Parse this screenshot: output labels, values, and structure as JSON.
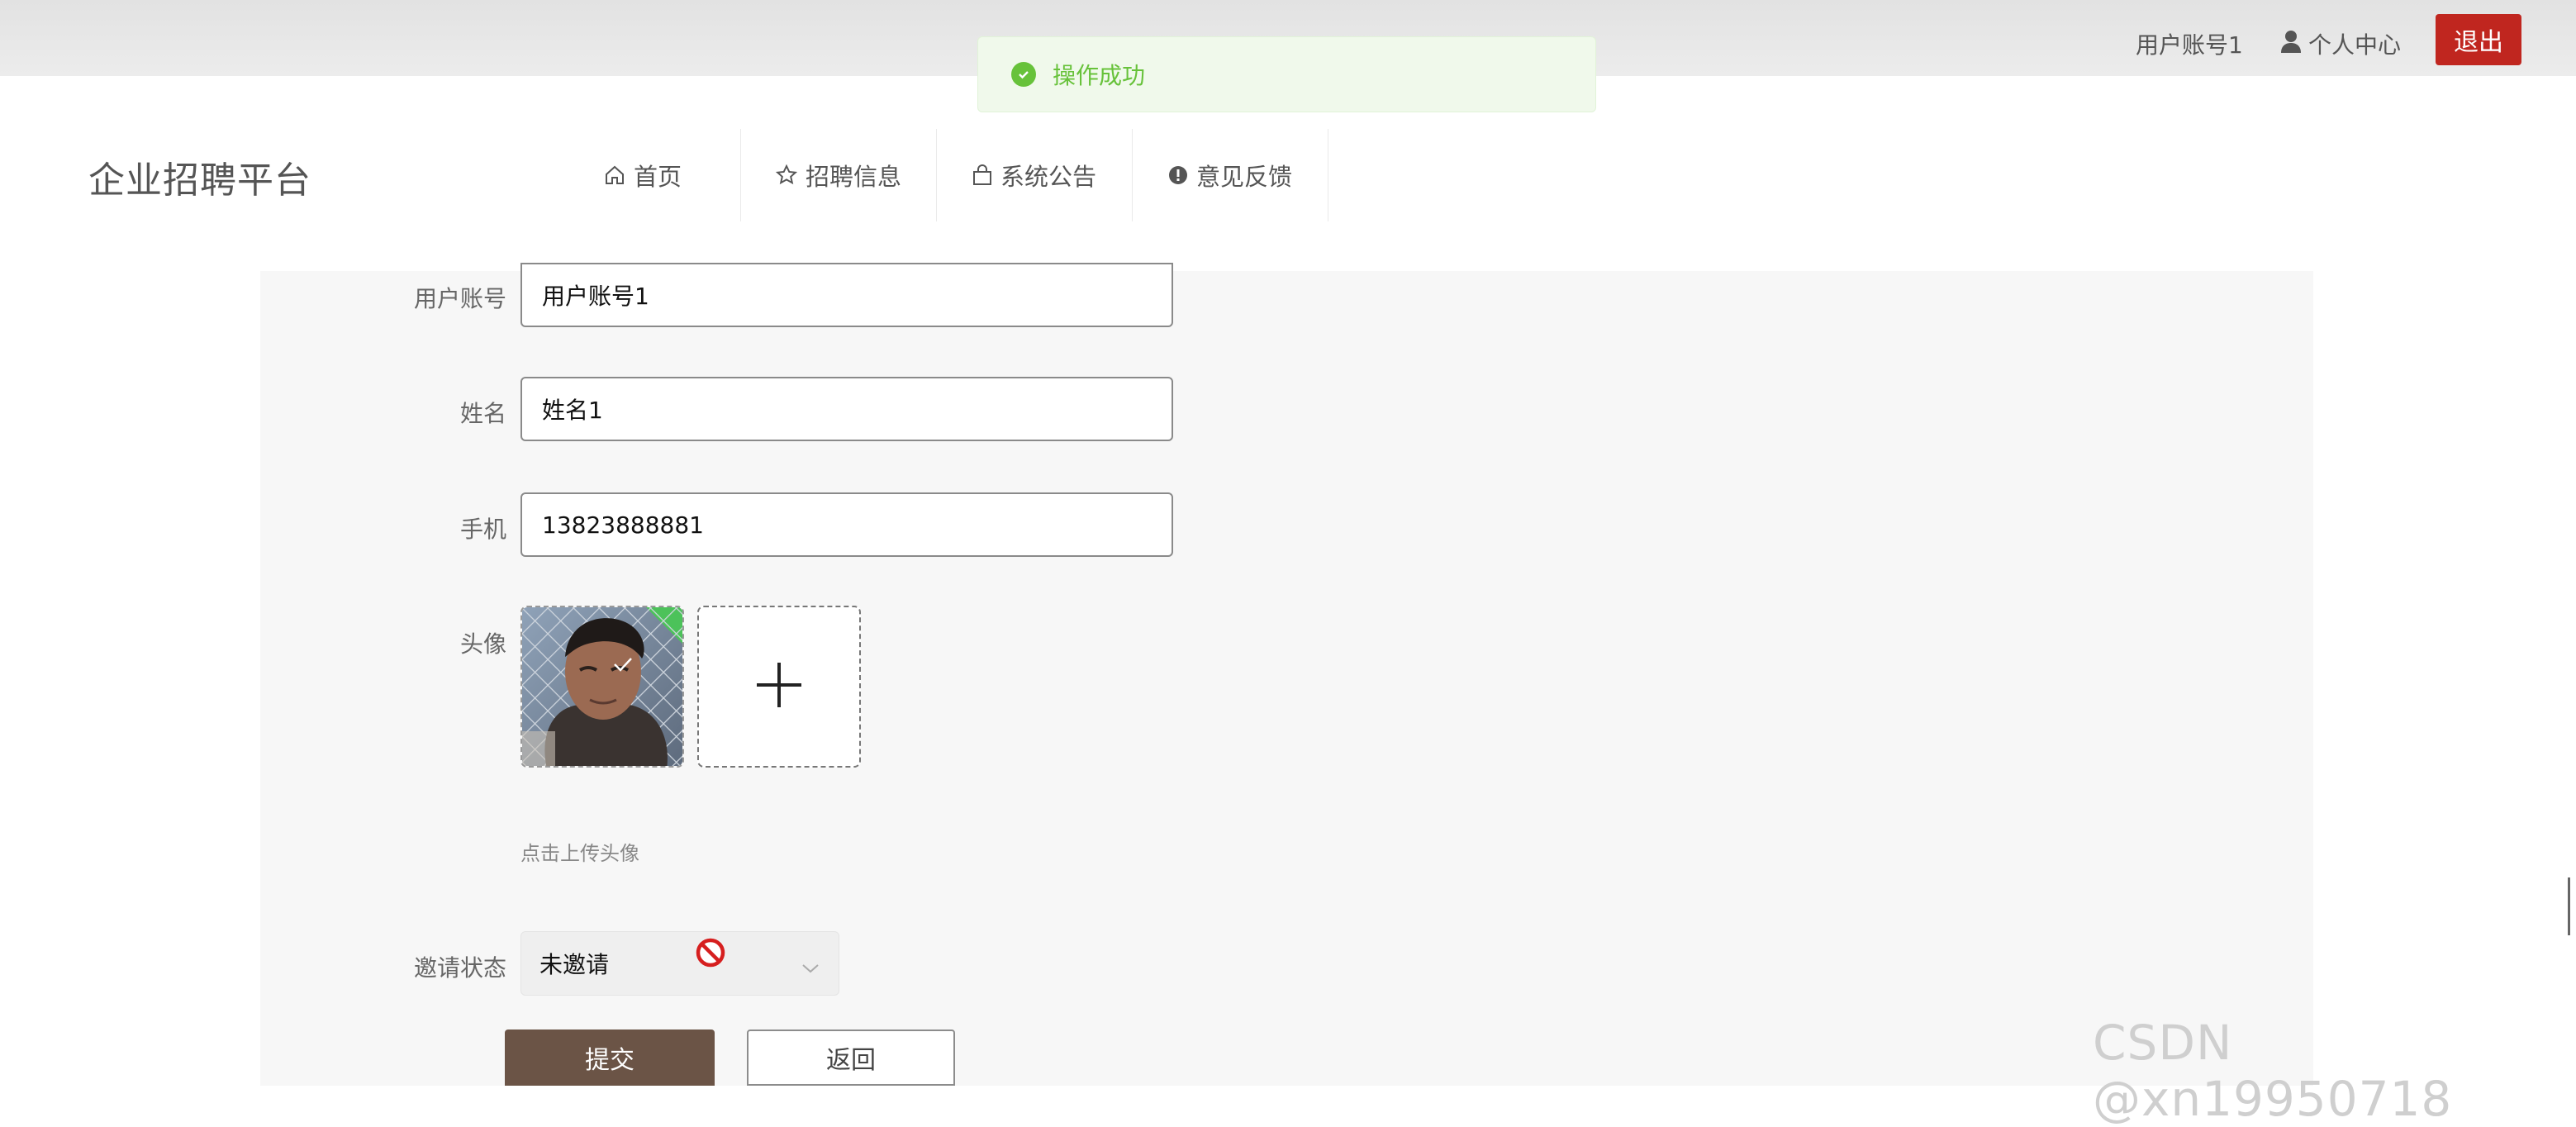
{
  "topbar": {
    "username": "用户账号1",
    "personal_center": "个人中心",
    "logout": "退出"
  },
  "toast": {
    "message": "操作成功"
  },
  "brand": {
    "title": "企业招聘平台"
  },
  "nav": {
    "items": [
      {
        "label": "首页",
        "icon": "home-icon"
      },
      {
        "label": "招聘信息",
        "icon": "star-icon"
      },
      {
        "label": "系统公告",
        "icon": "bag-icon"
      },
      {
        "label": "意见反馈",
        "icon": "info-icon"
      }
    ]
  },
  "form": {
    "account_label": "用户账号",
    "account_value": "用户账号1",
    "name_label": "姓名",
    "name_value": "姓名1",
    "phone_label": "手机",
    "phone_value": "13823888881",
    "avatar_label": "头像",
    "upload_hint": "点击上传头像",
    "invite_label": "邀请状态",
    "invite_value": "未邀请",
    "submit": "提交",
    "back": "返回"
  },
  "watermark": "CSDN @xn19950718",
  "colors": {
    "logout": "#c0261f",
    "toast_text": "#67c23a",
    "submit_bg": "#6b5446"
  }
}
